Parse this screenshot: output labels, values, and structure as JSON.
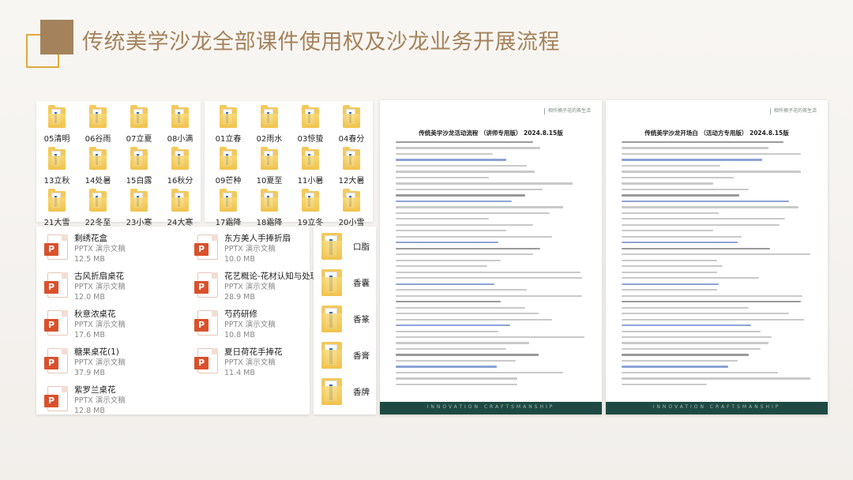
{
  "title": "传统美学沙龙全部课件使用权及沙龙业务开展流程",
  "folders_a": [
    "05清明",
    "06谷雨",
    "07立夏",
    "08小满",
    "13立秋",
    "14处暑",
    "15白露",
    "16秋分",
    "21大雪",
    "22冬至",
    "23小寒",
    "24大寒"
  ],
  "folders_b": [
    "01立春",
    "02雨水",
    "03惊蛰",
    "04春分",
    "09芒种",
    "10夏至",
    "11小暑",
    "12大暑",
    "17霜降",
    "18霜降",
    "19立冬",
    "20小雪"
  ],
  "files": [
    {
      "name": "剩绣花盒",
      "type": "PPTX 演示文稿",
      "size": "12.5 MB"
    },
    {
      "name": "东方美人手捧折扇",
      "type": "PPTX 演示文稿",
      "size": "10.0 MB"
    },
    {
      "name": "古风折扇桌花",
      "type": "PPTX 演示文稿",
      "size": "12.0 MB"
    },
    {
      "name": "花艺概论-花材认知与处理",
      "type": "PPTX 演示文稿",
      "size": "28.9 MB"
    },
    {
      "name": "秋意浓桌花",
      "type": "PPTX 演示文稿",
      "size": "17.6 MB"
    },
    {
      "name": "芍药研修",
      "type": "PPTX 演示文稿",
      "size": "10.8 MB"
    },
    {
      "name": "糖果桌花(1)",
      "type": "PPTX 演示文稿",
      "size": "37.9 MB"
    },
    {
      "name": "夏日荷花手捧花",
      "type": "PPTX 演示文稿",
      "size": "11.4 MB"
    },
    {
      "name": "紫罗兰桌花",
      "type": "PPTX 演示文稿",
      "size": "12.8 MB"
    }
  ],
  "big_folders": [
    "口脂",
    "香囊",
    "香篆",
    "香膏",
    "香牌"
  ],
  "doc1": {
    "brand": "相作摘子花的茶生活",
    "title": "传统美学沙龙活动流程 （讲师专用版）  2024.8.15版",
    "footer": "INNOVATION  CRAFTSMANSHIP"
  },
  "doc2": {
    "brand": "相作摘子花的茶生活",
    "title": "传统美学沙龙开场白 （活动方专用版）  2024.8.15版",
    "footer": "INNOVATION  CRAFTSMANSHIP"
  },
  "icons": {
    "ppt_badge": "P",
    "folder": "folder-icon",
    "ppt": "pptx-file-icon"
  },
  "colors": {
    "accent": "#a4835c",
    "frame": "#e0a83c",
    "ppt": "#d9512c",
    "folder": "#f3c95a",
    "doc_footer": "#1f4a44"
  }
}
